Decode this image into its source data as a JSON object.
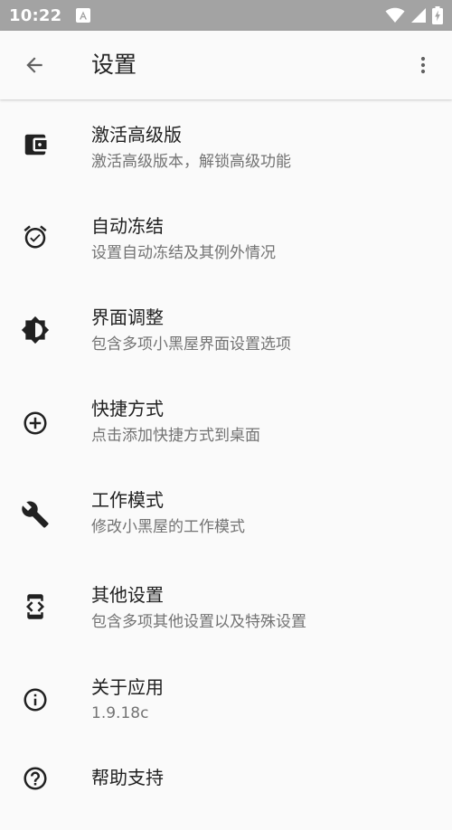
{
  "status_bar": {
    "time": "10:22",
    "icons": [
      "a-notification-icon",
      "wifi-icon",
      "signal-icon",
      "battery-charging-icon"
    ]
  },
  "app_bar": {
    "title": "设置",
    "back_icon": "arrow-back-icon",
    "menu_icon": "more-vert-icon"
  },
  "settings": {
    "items": [
      {
        "id": "activate-premium",
        "icon": "wallet-icon",
        "title": "激活高级版",
        "subtitle": "激活高级版本，解锁高级功能"
      },
      {
        "id": "auto-freeze",
        "icon": "alarm-check-icon",
        "title": "自动冻结",
        "subtitle": "设置自动冻结及其例外情况"
      },
      {
        "id": "ui-adjust",
        "icon": "brightness-icon",
        "title": "界面调整",
        "subtitle": "包含多项小黑屋界面设置选项"
      },
      {
        "id": "shortcuts",
        "icon": "add-circle-icon",
        "title": "快捷方式",
        "subtitle": "点击添加快捷方式到桌面"
      },
      {
        "id": "work-mode",
        "icon": "wrench-icon",
        "title": "工作模式",
        "subtitle": "修改小黑屋的工作模式"
      },
      {
        "id": "other-settings",
        "icon": "developer-mode-icon",
        "title": "其他设置",
        "subtitle": "包含多项其他设置以及特殊设置"
      },
      {
        "id": "about",
        "icon": "info-icon",
        "title": "关于应用",
        "subtitle": "1.9.18c"
      },
      {
        "id": "help",
        "icon": "help-icon",
        "title": "帮助支持",
        "subtitle": ""
      }
    ]
  }
}
